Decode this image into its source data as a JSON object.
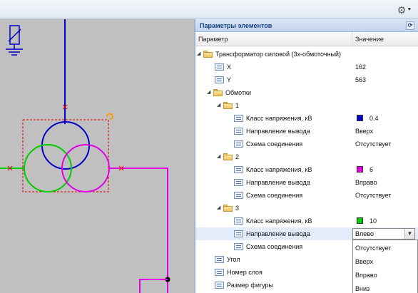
{
  "toolbar": {
    "menu_icon": "gear-icon"
  },
  "panel": {
    "title": "Параметры элементов",
    "refresh_icon": "refresh-icon",
    "col_param": "Параметр",
    "col_value": "Значение"
  },
  "tree": {
    "root": "Трансформатор силовой (3х-обмоточный)",
    "x_label": "X",
    "x_value": "162",
    "y_label": "Y",
    "y_value": "563",
    "windings": "Обмотки",
    "w1": {
      "name": "1",
      "voltage_label": "Класс напряжения, кВ",
      "voltage_color": "#0000c8",
      "voltage_value": "0.4",
      "dir_label": "Направление вывода",
      "dir_value": "Вверх",
      "scheme_label": "Схема соединения",
      "scheme_value": "Отсутствует"
    },
    "w2": {
      "name": "2",
      "voltage_label": "Класс напряжения, кВ",
      "voltage_color": "#e000e0",
      "voltage_value": "6",
      "dir_label": "Направление вывода",
      "dir_value": "Вправо",
      "scheme_label": "Схема соединения",
      "scheme_value": "Отсутствует"
    },
    "w3": {
      "name": "3",
      "voltage_label": "Класс напряжения, кВ",
      "voltage_color": "#00cc00",
      "voltage_value": "10",
      "dir_label": "Направление вывода",
      "dir_value": "Влево",
      "scheme_label": "Схема соединения"
    },
    "angle": "Угол",
    "layer": "Номер слоя",
    "size": "Размер фигуры"
  },
  "dropdown": {
    "options": [
      "Отсутствует",
      "Вверх",
      "Вправо",
      "Вниз"
    ]
  },
  "colors": {
    "hv_line": "#0000c8",
    "mv_line": "#e000e0",
    "lv_line": "#00cc00",
    "selection": "#e00000",
    "rotate_handle": "#ff9900"
  }
}
